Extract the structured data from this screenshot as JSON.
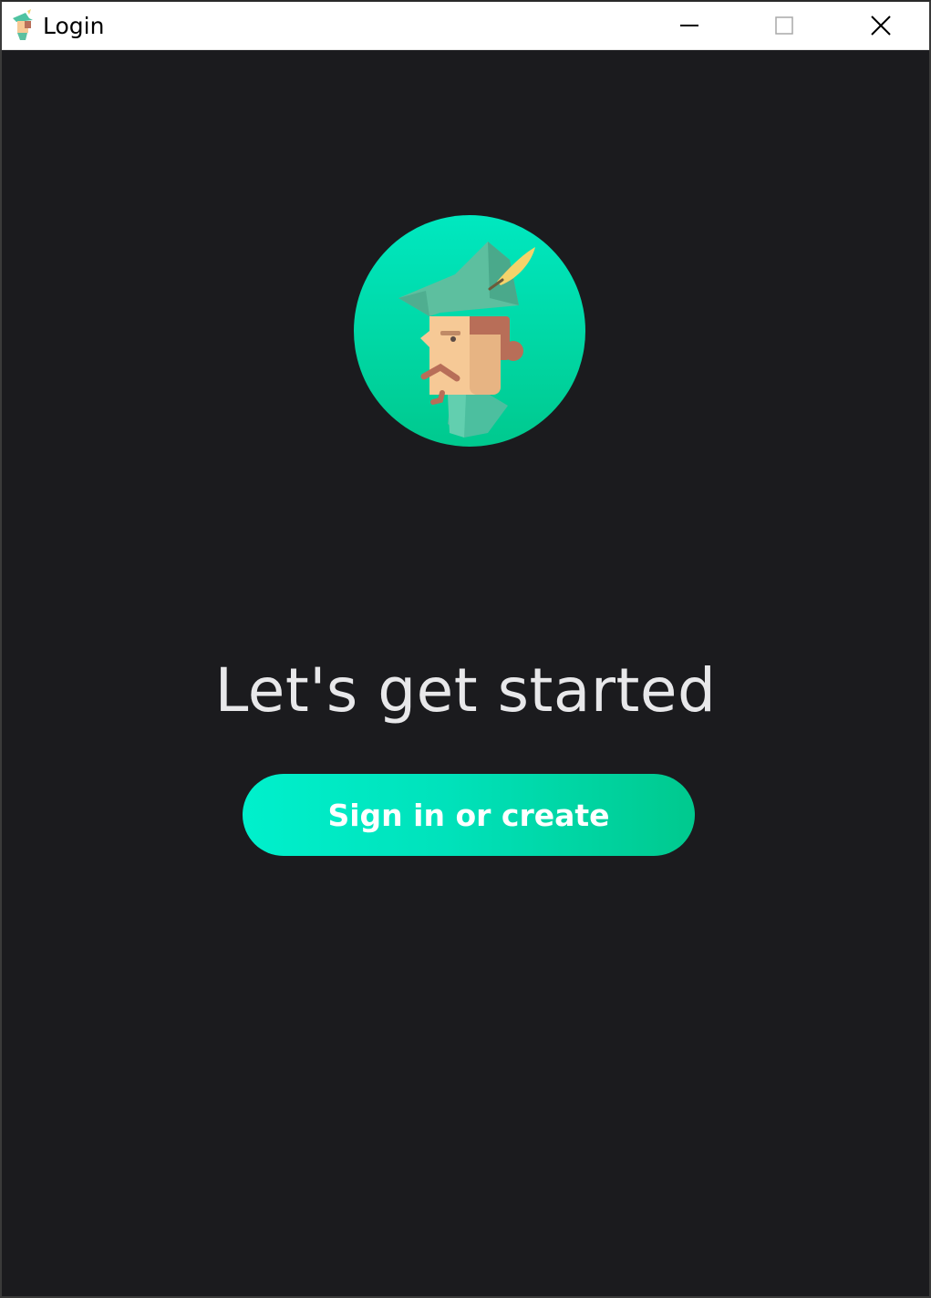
{
  "window": {
    "title": "Login",
    "controls": {
      "minimize_icon": "minimize-icon",
      "maximize_icon": "maximize-icon",
      "close_icon": "close-icon"
    }
  },
  "main": {
    "avatar_icon": "robin-hood-avatar-icon",
    "headline": "Let's get started",
    "signin_button_label": "Sign in or create"
  },
  "colors": {
    "background": "#1b1b1e",
    "accent_start": "#00f0cc",
    "accent_end": "#00c98e",
    "headline_text": "#e8e8ea"
  }
}
